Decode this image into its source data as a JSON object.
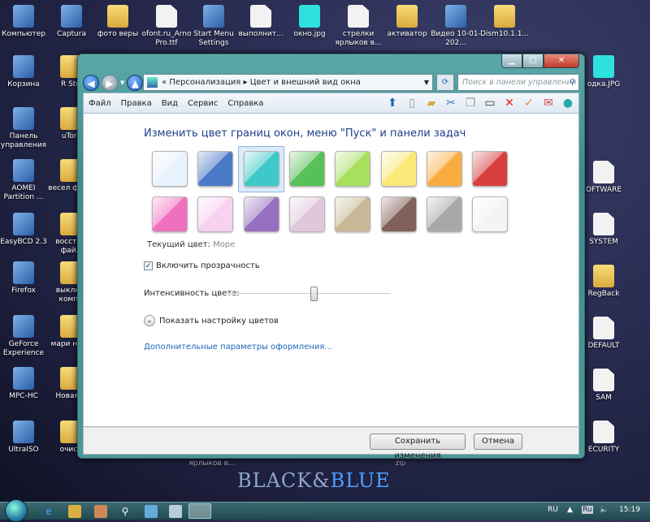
{
  "desktop": {
    "top_row": [
      "Компьютер",
      "Captura",
      "фото веры",
      "ofont.ru_Arno Pro.ttf",
      "Start Menu Settings",
      "выполнит...",
      "окно.jpg",
      "стрелки ярлыков в...",
      "активатор",
      "Видео 10-01-202...",
      "Dism10.1.1..."
    ],
    "left_column": [
      "Корзина",
      "Панель управления",
      "AOMEI Partition ...",
      "EasyBCD 2.3",
      "Firefox",
      "GeForce Experience",
      "MPC-HC",
      "UltraISO"
    ],
    "second_column": [
      "R Stu",
      "uTorr",
      "весел ферм",
      "восстан файл",
      "выключ компь",
      "мари нова",
      "Новая п",
      "очист"
    ],
    "right_column": [
      "одка.JPG",
      "OFTWARE",
      "SYSTEM",
      "RegBack",
      "DEFAULT",
      "SAM",
      "ECURITY"
    ],
    "under_window": [
      "ярлыков в...",
      "zip"
    ],
    "wallpaper_logo": "Black&Blue"
  },
  "window": {
    "breadcrumb": {
      "prefix": "«",
      "items": [
        "Персонализация",
        "Цвет и внешний вид окна"
      ],
      "separator": "▸"
    },
    "search_placeholder": "Поиск в панели управления",
    "menu": [
      "Файл",
      "Правка",
      "Вид",
      "Сервис",
      "Справка"
    ],
    "toolbar_icons": [
      "up-icon",
      "blank-page-icon",
      "folder-options-icon",
      "cut-icon",
      "copy-icon",
      "paste-icon",
      "delete-icon",
      "check-icon",
      "mail-icon",
      "globe-icon"
    ],
    "heading": "Изменить цвет границ окон, меню \"Пуск\" и панели задач",
    "swatches": [
      "#e8f2fc",
      "#4a78c8",
      "#3ec8c8",
      "#58c058",
      "#a8e060",
      "#fae878",
      "#fbac40",
      "#d84040",
      "#f070c0",
      "#f8d0f0",
      "#9870c0",
      "#e0c8dc",
      "#c8b898",
      "#806058",
      "#a8a8a8",
      "#f4f4f4"
    ],
    "selected_swatch": 2,
    "current_color_label": "Текущий цвет:",
    "current_color_value": "Море",
    "transparency_label": "Включить прозрачность",
    "transparency_checked": true,
    "intensity_label": "Интенсивность цвета:",
    "intensity_percent": 53,
    "show_mixer_label": "Показать настройку цветов",
    "advanced_link": "Дополнительные параметры оформления...",
    "save_button": "Сохранить изменения",
    "cancel_button": "Отмена"
  },
  "taskbar": {
    "lang": "RU",
    "lang_badge": "Ru",
    "time": "15:19"
  }
}
